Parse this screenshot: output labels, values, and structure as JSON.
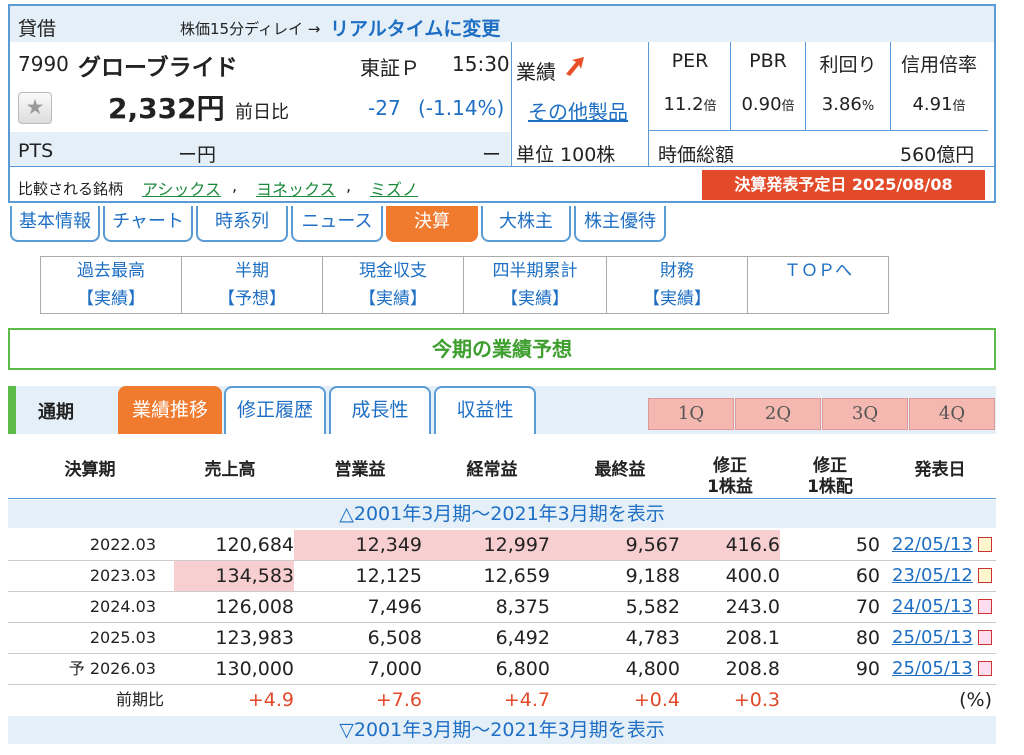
{
  "header": {
    "lending": "貸借",
    "delay_note": "株価15分ディレイ →",
    "realtime_link": "リアルタイムに変更",
    "code": "7990",
    "company": "グローブライド",
    "market": "東証Ｐ",
    "time": "15:30",
    "price": "2,332円",
    "prev_label": "前日比",
    "change": "-27",
    "change_pct": "(-1.14%)",
    "pts_label": "PTS",
    "pts_value": "ー円",
    "pts_diff": "ー",
    "gyoseki": "業績",
    "other_products": "その他製品",
    "unit": "単位 100株",
    "metrics": [
      {
        "label": "PER",
        "value": "11.2",
        "unit": "倍"
      },
      {
        "label": "PBR",
        "value": "0.90",
        "unit": "倍"
      },
      {
        "label": "利回り",
        "value": "3.86",
        "unit": "%"
      },
      {
        "label": "信用倍率",
        "value": "4.91",
        "unit": "倍"
      }
    ],
    "market_cap_label": "時価総額",
    "market_cap": "560億円",
    "compare_label": "比較される銘柄",
    "compare": [
      "アシックス",
      "ヨネックス",
      "ミズノ"
    ],
    "earnings_date": "決算発表予定日  2025/08/08"
  },
  "nav_tabs": [
    "基本情報",
    "チャート",
    "時系列",
    "ニュース",
    "決算",
    "大株主",
    "株主優待"
  ],
  "sub_nav": [
    {
      "l1": "過去最高",
      "l2": "【実績】"
    },
    {
      "l1": "半期",
      "l2": "【予想】"
    },
    {
      "l1": "現金収支",
      "l2": "【実績】"
    },
    {
      "l1": "四半期累計",
      "l2": "【実績】"
    },
    {
      "l1": "財務",
      "l2": "【実績】"
    },
    {
      "l1": "ＴＯＰへ",
      "l2": ""
    }
  ],
  "section_title": "今期の業績予想",
  "period_label": "通期",
  "inner_tabs": [
    "業績推移",
    "修正履歴",
    "成長性",
    "収益性"
  ],
  "quarter_tabs": [
    "1Q",
    "2Q",
    "3Q",
    "4Q"
  ],
  "table": {
    "headers": [
      "決算期",
      "売上高",
      "営業益",
      "経常益",
      "最終益",
      "修正\n1株益",
      "修正\n1株配",
      "発表日"
    ],
    "show_top": "△2001年3月期～2021年3月期を表示",
    "show_bottom": "▽2001年3月期～2021年3月期を表示",
    "rows": [
      {
        "period": "2022.03",
        "sales": "120,684",
        "op": "12,349",
        "ord": "12,997",
        "net": "9,567",
        "eps": "416.6",
        "div": "50",
        "date": "22/05/13"
      },
      {
        "period": "2023.03",
        "sales": "134,583",
        "op": "12,125",
        "ord": "12,659",
        "net": "9,188",
        "eps": "400.0",
        "div": "60",
        "date": "23/05/12"
      },
      {
        "period": "2024.03",
        "sales": "126,008",
        "op": "7,496",
        "ord": "8,375",
        "net": "5,582",
        "eps": "243.0",
        "div": "70",
        "date": "24/05/13"
      },
      {
        "period": "2025.03",
        "sales": "123,983",
        "op": "6,508",
        "ord": "6,492",
        "net": "4,783",
        "eps": "208.1",
        "div": "80",
        "date": "25/05/13"
      },
      {
        "period": "予 2026.03",
        "sales": "130,000",
        "op": "7,000",
        "ord": "6,800",
        "net": "4,800",
        "eps": "208.8",
        "div": "90",
        "date": "25/05/13"
      }
    ],
    "yoy": {
      "label": "前期比",
      "sales": "+4.9",
      "op": "+7.6",
      "ord": "+4.7",
      "net": "+0.4",
      "eps": "+0.3",
      "unit": "(%)"
    }
  }
}
